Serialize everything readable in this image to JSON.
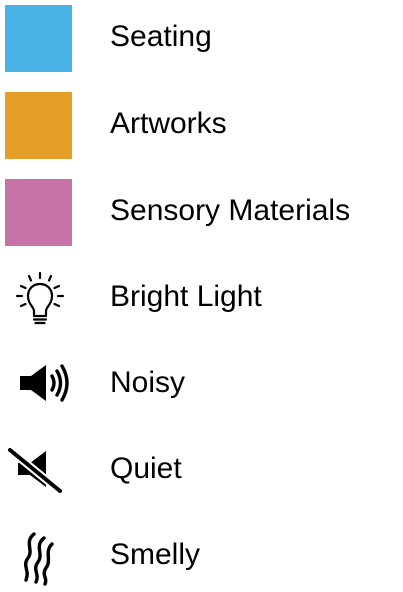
{
  "legend": {
    "items": [
      {
        "label": "Seating",
        "kind": "swatch",
        "color": "#4AB3E5"
      },
      {
        "label": "Artworks",
        "kind": "swatch",
        "color": "#E59E2A"
      },
      {
        "label": "Sensory Materials",
        "kind": "swatch",
        "color": "#C873A7"
      },
      {
        "label": "Bright Light",
        "kind": "icon",
        "icon": "lightbulb-icon"
      },
      {
        "label": "Noisy",
        "kind": "icon",
        "icon": "speaker-loud-icon"
      },
      {
        "label": "Quiet",
        "kind": "icon",
        "icon": "speaker-muted-icon"
      },
      {
        "label": "Smelly",
        "kind": "icon",
        "icon": "odor-waves-icon"
      }
    ]
  }
}
